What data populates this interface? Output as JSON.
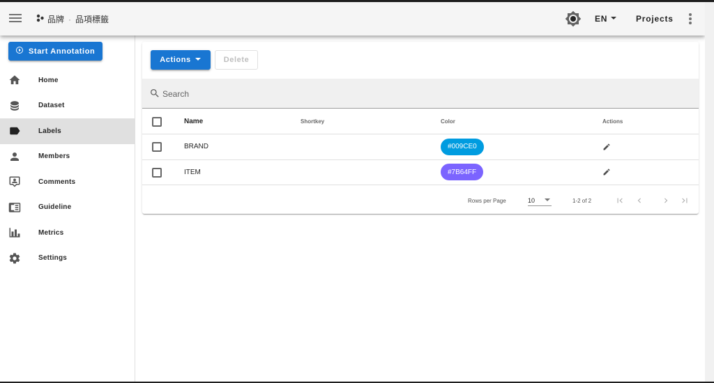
{
  "app": {
    "breadcrumb": {
      "project": "品牌",
      "separator": "·",
      "page": "品項標籤"
    },
    "language": "EN",
    "projects_label": "Projects"
  },
  "sidebar": {
    "start_label": "Start Annotation",
    "items": [
      {
        "label": "Home",
        "icon": "home-icon"
      },
      {
        "label": "Dataset",
        "icon": "database-icon"
      },
      {
        "label": "Labels",
        "icon": "label-icon",
        "active": true
      },
      {
        "label": "Members",
        "icon": "account-icon"
      },
      {
        "label": "Comments",
        "icon": "comment-account-icon"
      },
      {
        "label": "Guideline",
        "icon": "book-open-icon"
      },
      {
        "label": "Metrics",
        "icon": "chart-bar-icon"
      },
      {
        "label": "Settings",
        "icon": "cog-icon"
      }
    ]
  },
  "toolbar": {
    "actions_label": "Actions",
    "delete_label": "Delete"
  },
  "search": {
    "placeholder": "Search",
    "value": ""
  },
  "table": {
    "columns": [
      "Name",
      "Shortkey",
      "Color",
      "Actions"
    ],
    "rows": [
      {
        "name": "BRAND",
        "shortkey": "",
        "color": "#009CE0"
      },
      {
        "name": "ITEM",
        "shortkey": "",
        "color": "#7B64FF"
      }
    ]
  },
  "pagination": {
    "rows_per_page_label": "Rows per Page",
    "rows_per_page": "10",
    "range": "1-2 of 2"
  },
  "colors": {
    "primary": "#1976d2",
    "appbar": "#f5f5f5",
    "active_nav": "#e0e0e0"
  }
}
